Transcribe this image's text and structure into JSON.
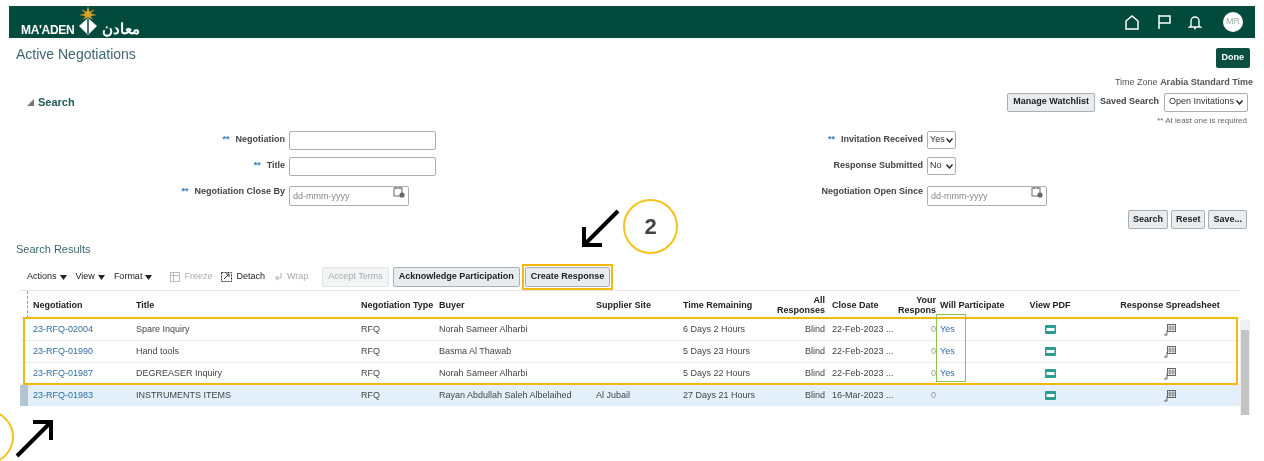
{
  "header": {
    "logo_text": "MA'ADEN",
    "logo_arabic": "معادن",
    "avatar": "MR"
  },
  "page": {
    "title": "Active Negotiations",
    "done_button": "Done",
    "time_zone": "Time Zone **Arabia Standard Time**"
  },
  "search": {
    "heading": "Search",
    "expanded": true,
    "manage_watchlist": "Manage Watchlist",
    "saved_search_label": "Saved Search",
    "saved_search_value": "Open Invitations",
    "required_note": "** At least one is required",
    "left_fields": [
      {
        "label": "Negotiation",
        "required_mark": "**",
        "kind": "text"
      },
      {
        "label": "Title",
        "required_mark": "**",
        "kind": "text"
      },
      {
        "label": "Negotiation Close By",
        "required_mark": "**",
        "kind": "date",
        "placeholder": "dd-mmm-yyyy"
      }
    ],
    "right_fields": [
      {
        "label": "Invitation Received",
        "required_mark": "**",
        "kind": "select",
        "value": "Yes"
      },
      {
        "label": "Response Submitted",
        "kind": "select",
        "value": "No"
      },
      {
        "label": "Negotiation Open Since",
        "kind": "date",
        "placeholder": "dd-mmm-yyyy"
      }
    ],
    "buttons": [
      "Search",
      "Reset",
      "Save..."
    ]
  },
  "results": {
    "heading": "Search Results",
    "toolbar": [
      {
        "label": "Actions",
        "kind": "menu",
        "disabled": false
      },
      {
        "label": "View",
        "kind": "menu",
        "disabled": false
      },
      {
        "label": "Format",
        "kind": "menu",
        "disabled": false
      },
      {
        "label": "Freeze",
        "kind": "freeze",
        "disabled": true
      },
      {
        "label": "Detach",
        "kind": "detach",
        "disabled": false
      },
      {
        "label": "Wrap",
        "kind": "wrap",
        "disabled": true
      },
      {
        "label": "Accept Terms",
        "kind": "button",
        "disabled": true
      },
      {
        "label": "Acknowledge Participation",
        "kind": "button",
        "disabled": false
      },
      {
        "label": "Create Response",
        "kind": "button",
        "disabled": false
      }
    ],
    "table": {
      "columns": [
        "Negotiation",
        "Title",
        "Negotiation Type",
        "Buyer",
        "Supplier Site",
        "Time Remaining",
        "All Responses",
        "Close Date",
        "Your Respons",
        "Will Participate",
        "View PDF",
        "Response Spreadsheet"
      ],
      "rows": [
        {
          "negotiation": "23-RFQ-02004",
          "title": "Spare Inquiry",
          "type": "RFQ",
          "buyer": "Norah Sameer Alharbi",
          "supplier_site": "",
          "time_remaining": "6 Days 2 Hours",
          "all_responses": "Blind",
          "close_date": "22-Feb-2023 ...",
          "your_responses": "0",
          "will_participate": "Yes",
          "selected": false
        },
        {
          "negotiation": "23-RFQ-01990",
          "title": "Hand tools",
          "type": "RFQ",
          "buyer": "Basma Al Thawab",
          "supplier_site": "",
          "time_remaining": "5 Days 23 Hours",
          "all_responses": "Blind",
          "close_date": "22-Feb-2023 ...",
          "your_responses": "0",
          "will_participate": "Yes",
          "selected": false
        },
        {
          "negotiation": "23-RFQ-01987",
          "title": "DEGREASER Inquiry",
          "type": "RFQ",
          "buyer": "Norah Sameer Alharbi",
          "supplier_site": "",
          "time_remaining": "5 Days 22 Hours",
          "all_responses": "Blind",
          "close_date": "22-Feb-2023 ...",
          "your_responses": "0",
          "will_participate": "Yes",
          "selected": false
        },
        {
          "negotiation": "23-RFQ-01983",
          "title": "INSTRUMENTS ITEMS",
          "type": "RFQ",
          "buyer": "Rayan Abdullah Saleh Albelaihed",
          "supplier_site": "Al Jubail",
          "time_remaining": "27 Days 21 Hours",
          "all_responses": "Blind",
          "close_date": "16-Mar-2023 ...",
          "your_responses": "0",
          "will_participate": "",
          "selected": true
        }
      ]
    }
  },
  "annotations": {
    "step_badge": "2"
  }
}
